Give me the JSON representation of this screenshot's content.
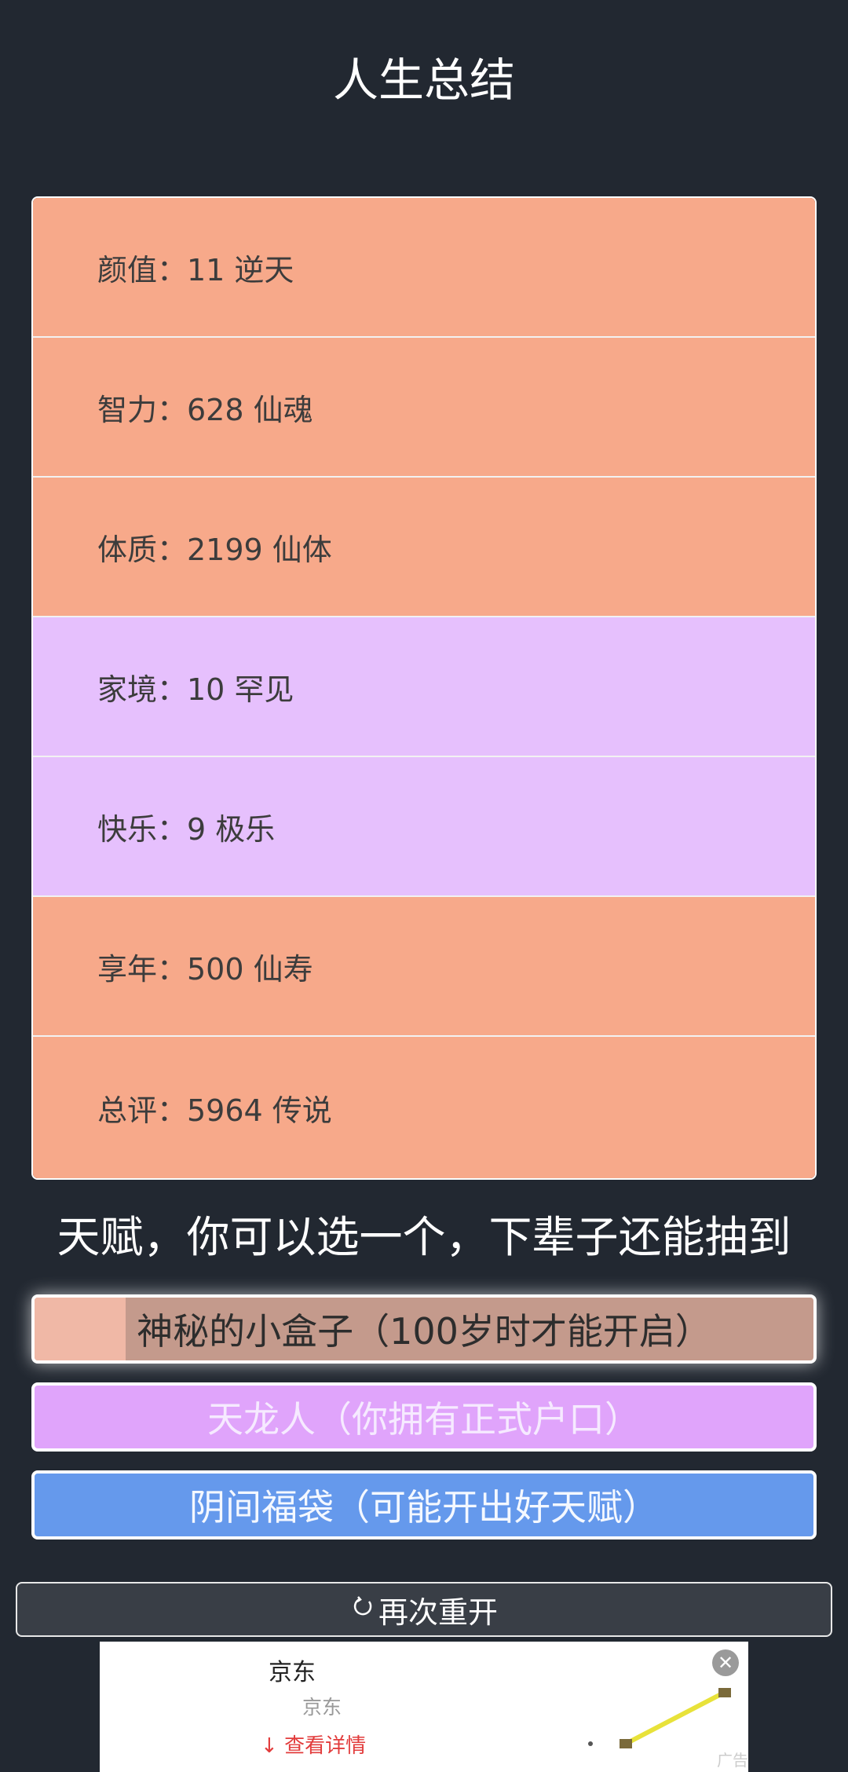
{
  "page_title": "人生总结",
  "stats": [
    {
      "label": "颜值：11 逆天",
      "tone": "orange"
    },
    {
      "label": "智力：628 仙魂",
      "tone": "orange"
    },
    {
      "label": "体质：2199 仙体",
      "tone": "orange"
    },
    {
      "label": "家境：10 罕见",
      "tone": "purple"
    },
    {
      "label": "快乐：9 极乐",
      "tone": "purple"
    },
    {
      "label": "享年：500 仙寿",
      "tone": "orange"
    },
    {
      "label": "总评：5964 传说",
      "tone": "orange"
    }
  ],
  "talent_prompt": "天赋，你可以选一个，下辈子还能抽到",
  "talents": [
    {
      "label": "神秘的小盒子（100岁时才能开启）"
    },
    {
      "label": "天龙人（你拥有正式户口）"
    },
    {
      "label": "阴间福袋（可能开出好天赋）"
    }
  ],
  "restart": {
    "icon": "refresh-icon",
    "label": "再次重开"
  },
  "ad": {
    "title": "京东",
    "subtitle": "京东",
    "link": "查看详情",
    "close_icon": "close-icon",
    "tag": "广告"
  },
  "colors": {
    "background": "#222831",
    "stat_orange": "#f7a98a",
    "stat_purple": "#e6c0fd",
    "talent_box": "#c49a8c",
    "talent_dragon": "#e0a4fb",
    "talent_bag": "#6599ec",
    "ad_link": "#e23c3c"
  }
}
